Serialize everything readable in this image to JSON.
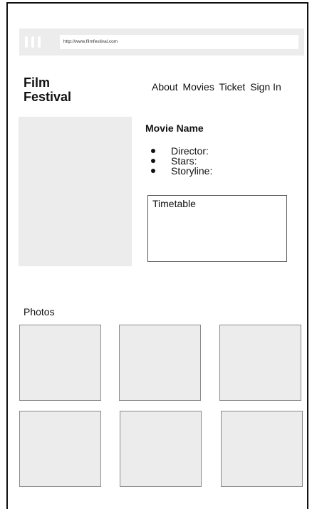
{
  "browser": {
    "url": "http://www.filmfestival.com",
    "icon": "browser-menu-icon"
  },
  "site": {
    "brand_line1": "Film",
    "brand_line2": "Festival"
  },
  "nav": {
    "items": [
      "About",
      "Movies",
      "Ticket",
      "Sign In"
    ]
  },
  "movie": {
    "title": "Movie Name",
    "details": [
      "Director:",
      "Stars:",
      "Storyline:"
    ],
    "timetable_label": "Timetable"
  },
  "photos": {
    "label": "Photos",
    "count": 6
  },
  "colors": {
    "placeholder_fill": "#ececec",
    "border": "#8a8a8a"
  }
}
